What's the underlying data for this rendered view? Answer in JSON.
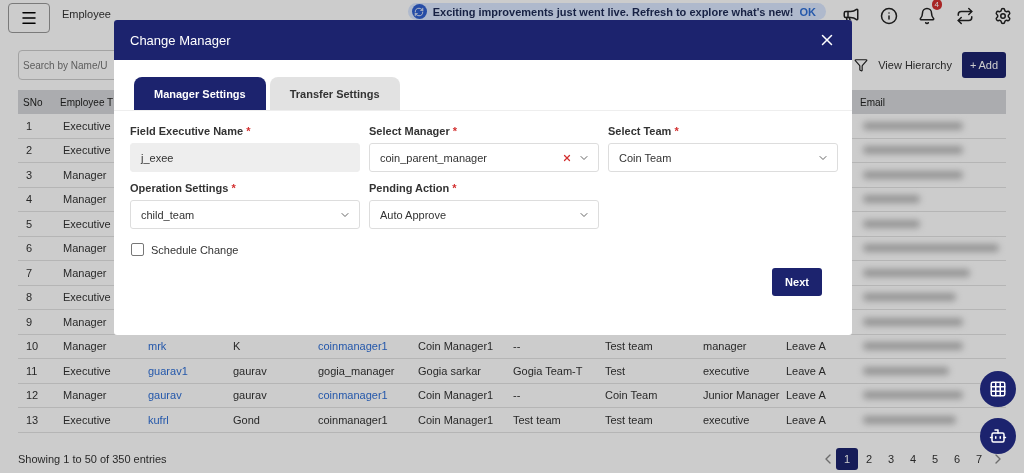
{
  "topbar": {
    "title": "Employee",
    "banner": "Exciting improvements just went live. Refresh to explore what's new!",
    "banner_action": "OK",
    "notification_count": "4"
  },
  "toolbar": {
    "search_placeholder": "Search by Name/U",
    "view_hierarchy": "View Hierarchy",
    "add_icon": "+",
    "add": "Add"
  },
  "table": {
    "columns": [
      "SNo",
      "Employee T",
      "",
      "",
      "",
      "",
      "",
      "",
      "",
      "",
      "Email"
    ],
    "rows": [
      {
        "cells": [
          "1",
          "Executive"
        ]
      },
      {
        "cells": [
          "2",
          "Executive"
        ]
      },
      {
        "cells": [
          "3",
          "Manager"
        ]
      },
      {
        "cells": [
          "4",
          "Manager"
        ]
      },
      {
        "cells": [
          "5",
          "Executive"
        ]
      },
      {
        "cells": [
          "6",
          "Manager"
        ]
      },
      {
        "cells": [
          "7",
          "Manager"
        ]
      },
      {
        "cells": [
          "8",
          "Executive"
        ]
      },
      {
        "cells": [
          "9",
          "Manager"
        ]
      },
      {
        "cells": [
          "10",
          "Manager",
          "mrk",
          "K",
          "coinmanager1",
          "Coin Manager1",
          "--",
          "Test team",
          "manager",
          "Leave A"
        ],
        "manager_link": true
      },
      {
        "cells": [
          "11",
          "Executive",
          "guarav1",
          "gaurav",
          "gogia_manager",
          "Gogia sarkar",
          "Gogia Team-T",
          "Test",
          "executive",
          "Leave A"
        ],
        "manager_link": false
      },
      {
        "cells": [
          "12",
          "Manager",
          "gaurav",
          "gaurav",
          "coinmanager1",
          "Coin Manager1",
          "--",
          "Coin Team",
          "Junior Manager",
          "Leave A"
        ],
        "manager_link": true
      },
      {
        "cells": [
          "13",
          "Executive",
          "kufrl",
          "Gond",
          "coinmanager1",
          "Coin Manager1",
          "Test team",
          "Test team",
          "executive",
          "Leave A"
        ],
        "manager_link": false
      }
    ]
  },
  "footer": {
    "summary": "Showing 1 to 50 of 350 entries",
    "pages": [
      {
        "label": "1",
        "selected": true
      },
      {
        "label": "2",
        "selected": false
      },
      {
        "label": "3",
        "selected": false
      },
      {
        "label": "4",
        "selected": false
      },
      {
        "label": "5",
        "selected": false
      },
      {
        "label": "6",
        "selected": false
      },
      {
        "label": "7",
        "selected": false
      }
    ]
  },
  "dialog": {
    "title": "Change Manager",
    "tabs": [
      {
        "label": "Manager Settings",
        "selected": true
      },
      {
        "label": "Transfer Settings",
        "selected": false
      }
    ],
    "fields": [
      {
        "kind": "text",
        "label": "Field Executive Name",
        "mark": "*",
        "value": "j_exee",
        "disabled": true
      },
      {
        "kind": "select",
        "label": "Select Manager",
        "mark": "*",
        "value": "coin_parent_manager",
        "clearable": true
      },
      {
        "kind": "select",
        "label": "Select Team",
        "mark": "*",
        "value": "Coin Team",
        "clearable": false
      },
      {
        "kind": "select",
        "label": "Operation Settings",
        "mark": "*",
        "value": "child_team",
        "clearable": false
      },
      {
        "kind": "select",
        "label": "Pending Action",
        "mark": "*",
        "value": "Auto Approve",
        "clearable": false
      }
    ],
    "schedule": {
      "label": "Schedule Change",
      "checked": false
    },
    "next": "Next"
  }
}
